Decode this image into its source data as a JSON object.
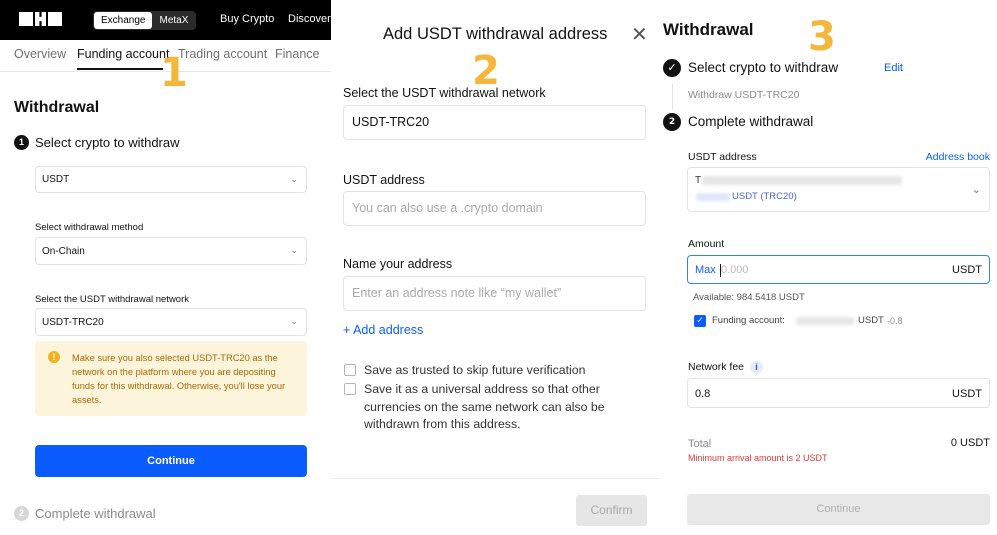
{
  "panel1": {
    "segment": [
      "Exchange",
      "MetaX"
    ],
    "topnav": [
      "Buy Crypto",
      "Discover"
    ],
    "subnav": [
      "Overview",
      "Funding account",
      "Trading account",
      "Finance"
    ],
    "step_number": "1",
    "heading": "Withdrawal",
    "step1": {
      "num": "1",
      "label": "Select crypto to withdraw"
    },
    "crypto_value": "USDT",
    "method_label": "Select withdrawal method",
    "method_value": "On-Chain",
    "network_label": "Select the USDT withdrawal network",
    "network_value": "USDT-TRC20",
    "warning": "Make sure you also selected USDT-TRC20 as the network on the platform where you are depositing funds for this withdrawal. Otherwise, you'll lose your assets.",
    "continue": "Continue",
    "step2": {
      "num": "2",
      "label": "Complete withdrawal"
    }
  },
  "panel2": {
    "step_number": "2",
    "title": "Add USDT withdrawal address",
    "close_glyph": "✕",
    "network_label": "Select the USDT withdrawal network",
    "network_value": "USDT-TRC20",
    "address_label": "USDT address",
    "address_placeholder": "You can also use a .crypto domain",
    "name_label": "Name your address",
    "name_placeholder": "Enter an address note like “my wallet”",
    "add_address": "+ Add address",
    "checkbox1": "Save as trusted to skip future verification",
    "checkbox2": "Save it as a universal address so that other currencies on the same network can also be withdrawn from this address.",
    "confirm": "Confirm"
  },
  "panel3": {
    "step_number": "3",
    "heading": "Withdrawal",
    "step1_label": "Select crypto to withdraw",
    "edit": "Edit",
    "step1_sub": "Withdraw USDT-TRC20",
    "step2_num": "2",
    "step2_label": "Complete withdrawal",
    "address_label": "USDT address",
    "address_book": "Address book",
    "address_prefix": "T",
    "address_network": "USDT (TRC20)",
    "amount_label": "Amount",
    "max": "Max",
    "amount_placeholder": "0.000",
    "unit": "USDT",
    "available": "Available:  984.5418 USDT",
    "funding_label": "Funding account:",
    "funding_unit": "USDT",
    "funding_delta": "-0.8",
    "fee_label": "Network fee",
    "fee_value": "0.8",
    "fee_unit": "USDT",
    "total_label": "Total",
    "total_value": "0 USDT",
    "min_arrival": "Minimum arrival amount is 2 USDT",
    "continue": "Continue"
  }
}
